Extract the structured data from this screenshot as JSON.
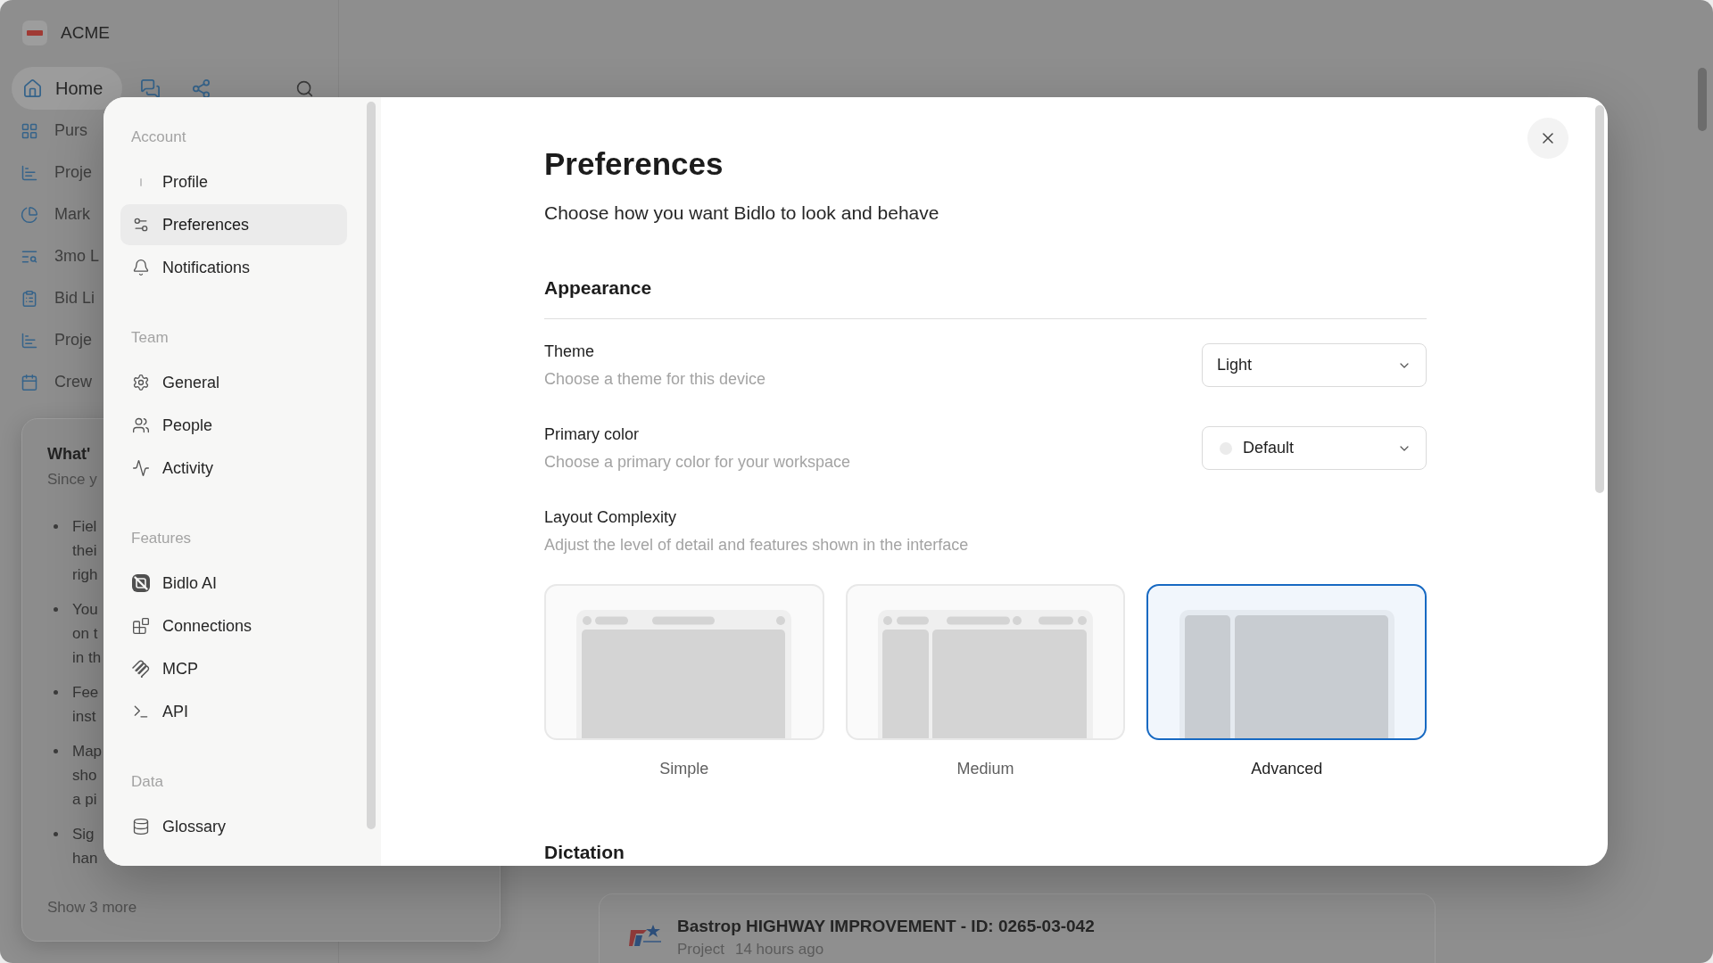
{
  "app": {
    "workspace_name": "ACME",
    "nav": {
      "home": {
        "label": "Home",
        "selected": true
      }
    },
    "sidebar_items": [
      {
        "label": "Purs"
      },
      {
        "label": "Proje"
      },
      {
        "label": "Mark"
      },
      {
        "label": "3mo L"
      },
      {
        "label": "Bid Li"
      },
      {
        "label": "Proje"
      },
      {
        "label": "Crew"
      }
    ],
    "whats_new": {
      "title": "What'",
      "subtitle": "Since y",
      "bullets": [
        {
          "lines": [
            "Fiel",
            "thei",
            "righ"
          ]
        },
        {
          "lines": [
            "You",
            "on t",
            "in th"
          ]
        },
        {
          "lines": [
            "Fee",
            "inst"
          ]
        },
        {
          "lines": [
            "Map",
            "sho",
            "a pi"
          ]
        },
        {
          "lines": [
            "Sig",
            "han"
          ]
        }
      ],
      "more_link": "Show 3 more"
    },
    "recent_item": {
      "title": "Bastrop HIGHWAY IMPROVEMENT - ID: 0265-03-042",
      "type": "Project",
      "time": "14 hours ago"
    }
  },
  "dialog": {
    "nav_sections": [
      {
        "heading": "Account",
        "items": [
          {
            "label": "Profile",
            "selected": false
          },
          {
            "label": "Preferences",
            "selected": true
          },
          {
            "label": "Notifications",
            "selected": false
          }
        ]
      },
      {
        "heading": "Team",
        "items": [
          {
            "label": "General",
            "selected": false
          },
          {
            "label": "People",
            "selected": false
          },
          {
            "label": "Activity",
            "selected": false
          }
        ]
      },
      {
        "heading": "Features",
        "items": [
          {
            "label": "Bidlo AI",
            "selected": false
          },
          {
            "label": "Connections",
            "selected": false
          },
          {
            "label": "MCP",
            "selected": false
          },
          {
            "label": "API",
            "selected": false
          }
        ]
      },
      {
        "heading": "Data",
        "items": [
          {
            "label": "Glossary",
            "selected": false
          }
        ]
      }
    ],
    "title": "Preferences",
    "subtitle": "Choose how you want Bidlo to look and behave",
    "sections": [
      {
        "heading": "Appearance",
        "settings": [
          {
            "kind": "select",
            "label": "Theme",
            "description": "Choose a theme for this device",
            "value": "Light"
          },
          {
            "kind": "color_select",
            "label": "Primary color",
            "description": "Choose a primary color for your workspace",
            "value": "Default"
          },
          {
            "kind": "layout_picker",
            "label": "Layout Complexity",
            "description": "Adjust the level of detail and features shown in the interface",
            "options": [
              {
                "kind": "simple",
                "label": "Simple",
                "selected": false
              },
              {
                "kind": "medium",
                "label": "Medium",
                "selected": false
              },
              {
                "kind": "advanced",
                "label": "Advanced",
                "selected": true
              }
            ]
          }
        ]
      },
      {
        "heading": "Dictation"
      }
    ]
  }
}
